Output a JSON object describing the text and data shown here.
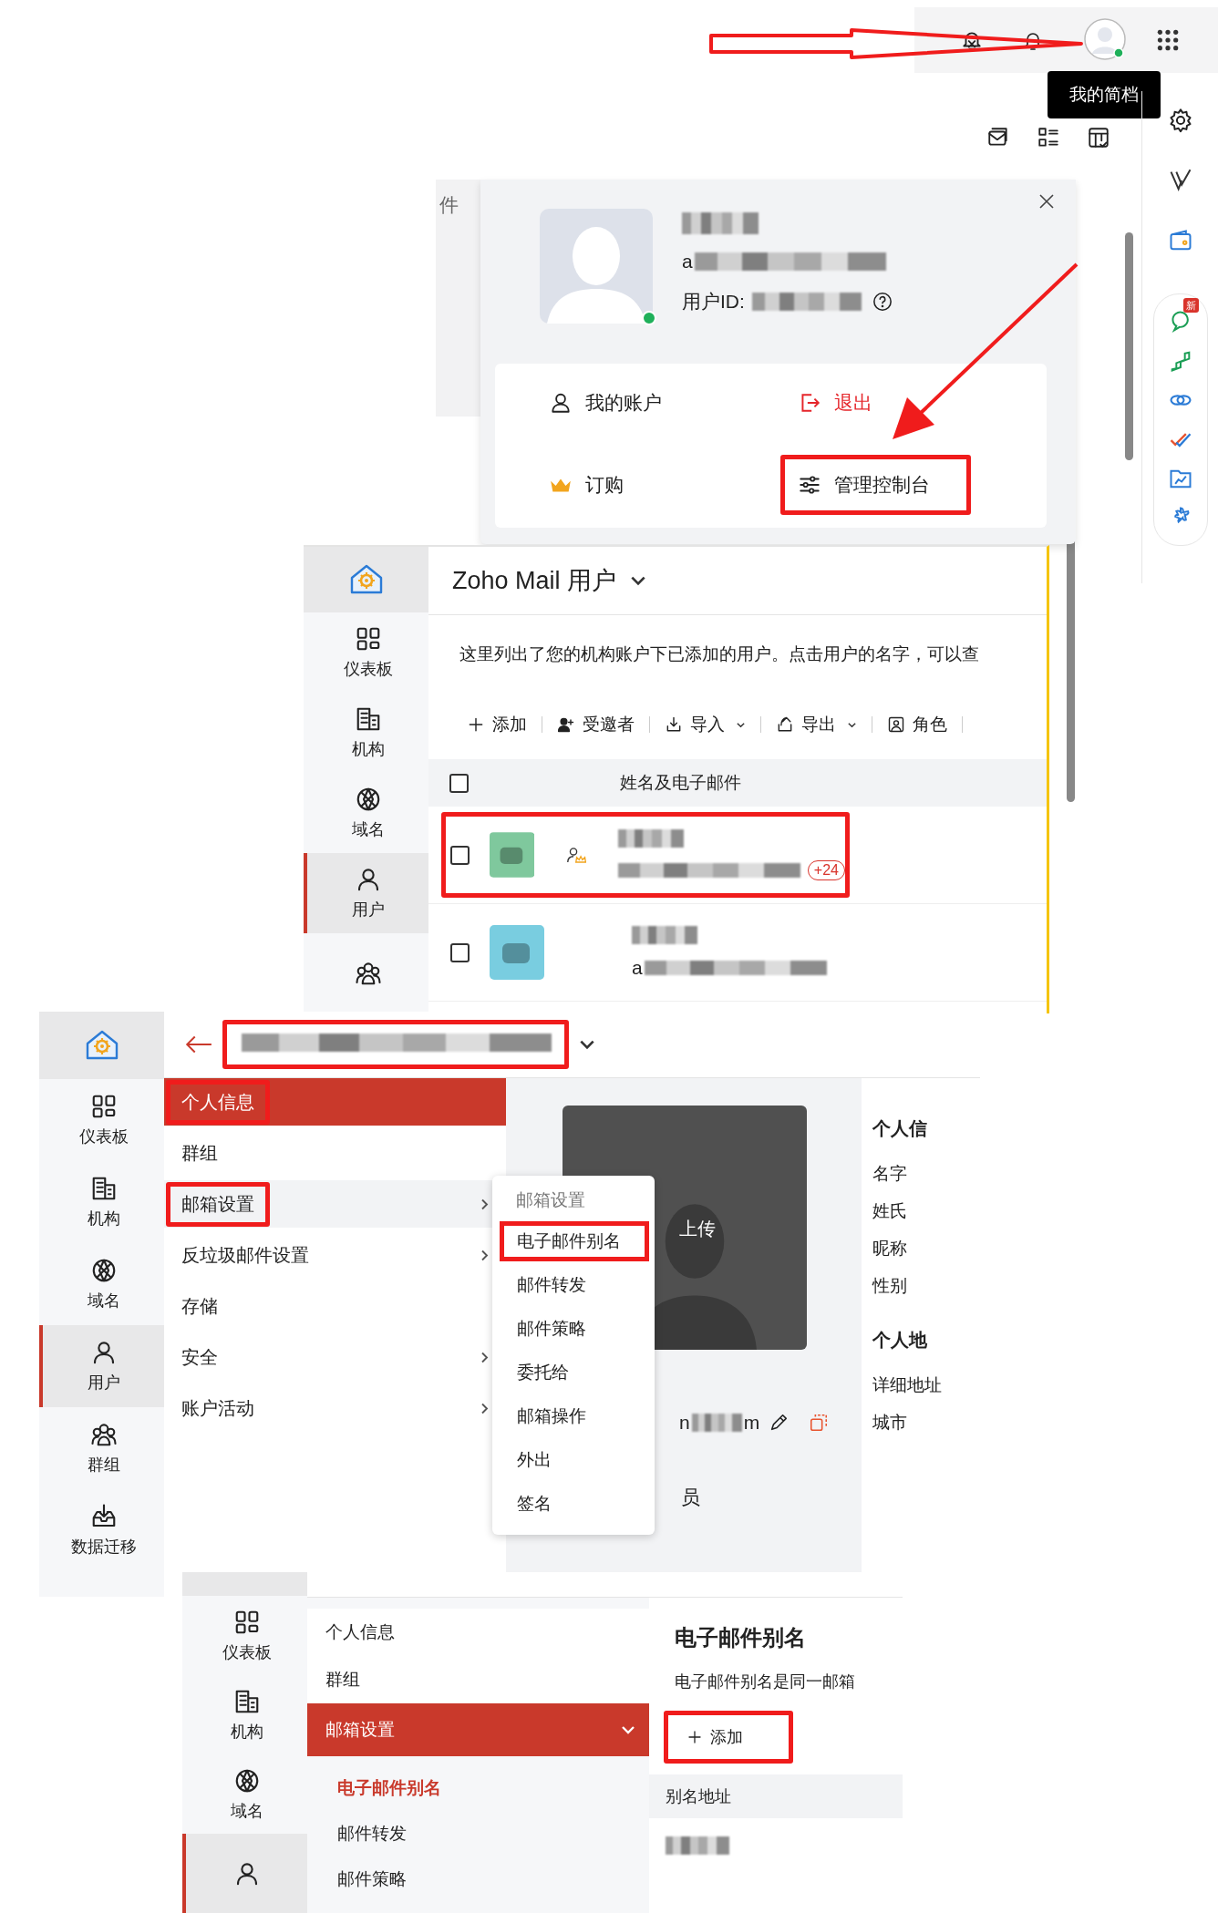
{
  "top_bar": {
    "tooltip": "我的简档"
  },
  "profile_popup": {
    "behind_tab": "件",
    "email_prefix": "a",
    "user_id_label": "用户ID:",
    "menu": [
      {
        "kind": "account",
        "label": "我的账户",
        "highlighted": false
      },
      {
        "kind": "logout",
        "label": "退出",
        "highlighted": false
      },
      {
        "kind": "subscription",
        "label": "订购",
        "highlighted": false
      },
      {
        "kind": "console",
        "label": "管理控制台",
        "highlighted": true
      }
    ]
  },
  "side_rail": {
    "badge": "新"
  },
  "users_panel": {
    "sidebar": [
      {
        "kind": "dashboard",
        "label": "仪表板",
        "selected": false
      },
      {
        "kind": "org",
        "label": "机构",
        "selected": false
      },
      {
        "kind": "domain",
        "label": "域名",
        "selected": false
      },
      {
        "kind": "user",
        "label": "用户",
        "selected": true
      },
      {
        "kind": "group",
        "selected": false
      }
    ],
    "title": "Zoho Mail 用户",
    "description": "这里列出了您的机构账户下已添加的用户。点击用户的名字，可以查",
    "toolbar": [
      {
        "kind": "add",
        "label": "添加",
        "dropdown": false
      },
      {
        "kind": "invitees",
        "label": "受邀者",
        "dropdown": false
      },
      {
        "kind": "import",
        "label": "导入",
        "dropdown": true
      },
      {
        "kind": "export",
        "label": "导出",
        "dropdown": true
      },
      {
        "kind": "roles",
        "label": "角色",
        "dropdown": false
      }
    ],
    "column": "姓名及电子邮件",
    "select_all_checked": false,
    "rows": [
      {
        "color": "#7fc89d",
        "admin": true,
        "badge": "+24",
        "highlighted": true,
        "checked": false
      },
      {
        "color": "#79cde0",
        "admin": false,
        "email_prefix": "a",
        "highlighted": false,
        "checked": false
      }
    ]
  },
  "user_detail_panel": {
    "name_highlighted": true,
    "sidebar": [
      {
        "kind": "dashboard",
        "label": "仪表板",
        "selected": false
      },
      {
        "kind": "org",
        "label": "机构",
        "selected": false
      },
      {
        "kind": "domain",
        "label": "域名",
        "selected": false
      },
      {
        "kind": "user",
        "label": "用户",
        "selected": true
      },
      {
        "kind": "group",
        "label": "群组",
        "selected": false
      },
      {
        "kind": "migration",
        "label": "数据迁移",
        "selected": false
      }
    ],
    "menu": [
      {
        "label": "个人信息",
        "selected": true,
        "highlighted": true,
        "hover": false,
        "submenu": false
      },
      {
        "label": "群组",
        "selected": false,
        "highlighted": false,
        "hover": false,
        "submenu": false
      },
      {
        "label": "邮箱设置",
        "selected": false,
        "highlighted": true,
        "hover": true,
        "submenu": true
      },
      {
        "label": "反垃圾邮件设置",
        "selected": false,
        "highlighted": false,
        "hover": false,
        "submenu": true
      },
      {
        "label": "存储",
        "selected": false,
        "highlighted": false,
        "hover": false,
        "submenu": false
      },
      {
        "label": "安全",
        "selected": false,
        "highlighted": false,
        "hover": false,
        "submenu": true
      },
      {
        "label": "账户活动",
        "selected": false,
        "highlighted": false,
        "hover": false,
        "submenu": true
      }
    ],
    "flyout": {
      "heading": "邮箱设置",
      "items": [
        {
          "label": "电子邮件别名",
          "highlighted": true
        },
        {
          "label": "邮件转发",
          "highlighted": false
        },
        {
          "label": "邮件策略",
          "highlighted": false
        },
        {
          "label": "委托给",
          "highlighted": false
        },
        {
          "label": "邮箱操作",
          "highlighted": false
        },
        {
          "label": "外出",
          "highlighted": false
        },
        {
          "label": "签名",
          "highlighted": false
        }
      ]
    },
    "upload_label": "上传",
    "email_prefix": "n",
    "email_suffix": "m",
    "role_fragment": "员",
    "details": [
      {
        "kind": "heading",
        "label": "个人信"
      },
      {
        "kind": "field",
        "label": "名字"
      },
      {
        "kind": "field",
        "label": "姓氏"
      },
      {
        "kind": "field",
        "label": "昵称"
      },
      {
        "kind": "field",
        "label": "性别"
      },
      {
        "kind": "heading",
        "label": "个人地"
      },
      {
        "kind": "field",
        "label": "详细地址"
      },
      {
        "kind": "field",
        "label": "城市"
      }
    ]
  },
  "alias_panel": {
    "sidebar": [
      {
        "kind": "dashboard",
        "label": "仪表板",
        "selected": false
      },
      {
        "kind": "org",
        "label": "机构",
        "selected": false
      },
      {
        "kind": "domain",
        "label": "域名",
        "selected": false
      },
      {
        "kind": "user",
        "selected": true
      }
    ],
    "menu": [
      {
        "kind": "item",
        "label": "个人信息",
        "selected": false
      },
      {
        "kind": "item",
        "label": "群组",
        "selected": false
      },
      {
        "kind": "group",
        "label": "邮箱设置",
        "selected": true,
        "expanded": true
      },
      {
        "kind": "subitem",
        "label": "电子邮件别名",
        "selected": true
      },
      {
        "kind": "subitem",
        "label": "邮件转发",
        "selected": false
      },
      {
        "kind": "subitem",
        "label": "邮件策略",
        "selected": false
      }
    ],
    "title": "电子邮件别名",
    "description": "电子邮件别名是同一邮箱",
    "add_button": {
      "label": "添加",
      "highlighted": true
    },
    "column": "别名地址"
  }
}
